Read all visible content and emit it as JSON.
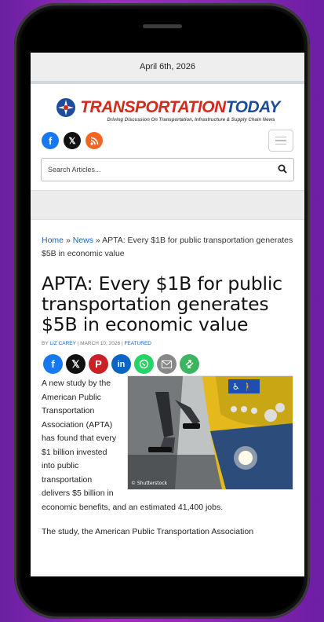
{
  "date": "April 6th, 2026",
  "logo": {
    "word_a": "TRANSPORTATION",
    "word_b": "TODAY",
    "tagline": "Driving Discussion On Transportation, Infrastructure & Supply Chain News"
  },
  "search": {
    "placeholder": "Search Articles..."
  },
  "breadcrumb": {
    "home": "Home",
    "sep": "»",
    "news": "News",
    "current": "APTA: Every $1B for public transportation generates $5B in economic value"
  },
  "article": {
    "title": "APTA: Every $1B for public transportation generates $5B in economic value",
    "byline_prefix": "BY",
    "author": "LIZ CAREY",
    "date": "MARCH 10, 2026",
    "category": "FEATURED",
    "image_credit": "© Shutterstock",
    "paragraph": "A new study by the American Public Transportation Association (APTA) has found that every $1 billion invested into public transportation delivers $5 billion in economic benefits, and an estimated 41,400 jobs.",
    "next_partial": "The study, the American Public Transportation Association"
  },
  "colors": {
    "brand_red": "#d42a1c",
    "brand_blue": "#1b4d9b",
    "link": "#1565c0"
  }
}
